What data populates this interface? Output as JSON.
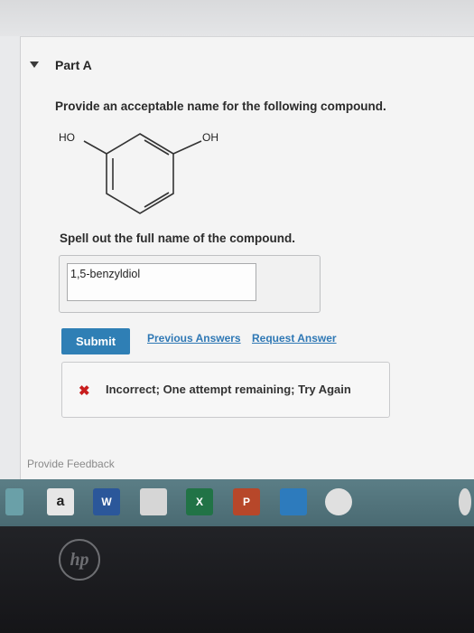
{
  "part": {
    "title": "Part A"
  },
  "question": {
    "prompt": "Provide an acceptable name for the following compound.",
    "molecule": {
      "left_label": "HO",
      "right_label": "OH"
    },
    "spell_prompt": "Spell out the full name of the compound."
  },
  "answer": {
    "value": "1,5-benzyldiol"
  },
  "actions": {
    "submit_label": "Submit",
    "previous_answers_label": "Previous Answers",
    "request_answer_label": "Request Answer"
  },
  "feedback": {
    "status_icon": "x-icon",
    "message": "Incorrect; One attempt remaining; Try Again",
    "error_color": "#c81e1e"
  },
  "footer": {
    "provide_feedback": "Provide Feedback"
  },
  "taskbar": {
    "icons": [
      {
        "name": "amazon-icon",
        "glyph": "a"
      },
      {
        "name": "word-icon",
        "glyph": "W"
      },
      {
        "name": "store-icon",
        "glyph": ""
      },
      {
        "name": "excel-icon",
        "glyph": "X"
      },
      {
        "name": "powerpoint-icon",
        "glyph": "P"
      },
      {
        "name": "photos-icon",
        "glyph": ""
      },
      {
        "name": "chrome-icon",
        "glyph": ""
      }
    ]
  },
  "device": {
    "brand": "hp"
  },
  "colors": {
    "submit": "#2f7fb5",
    "link": "#2f78b5"
  }
}
